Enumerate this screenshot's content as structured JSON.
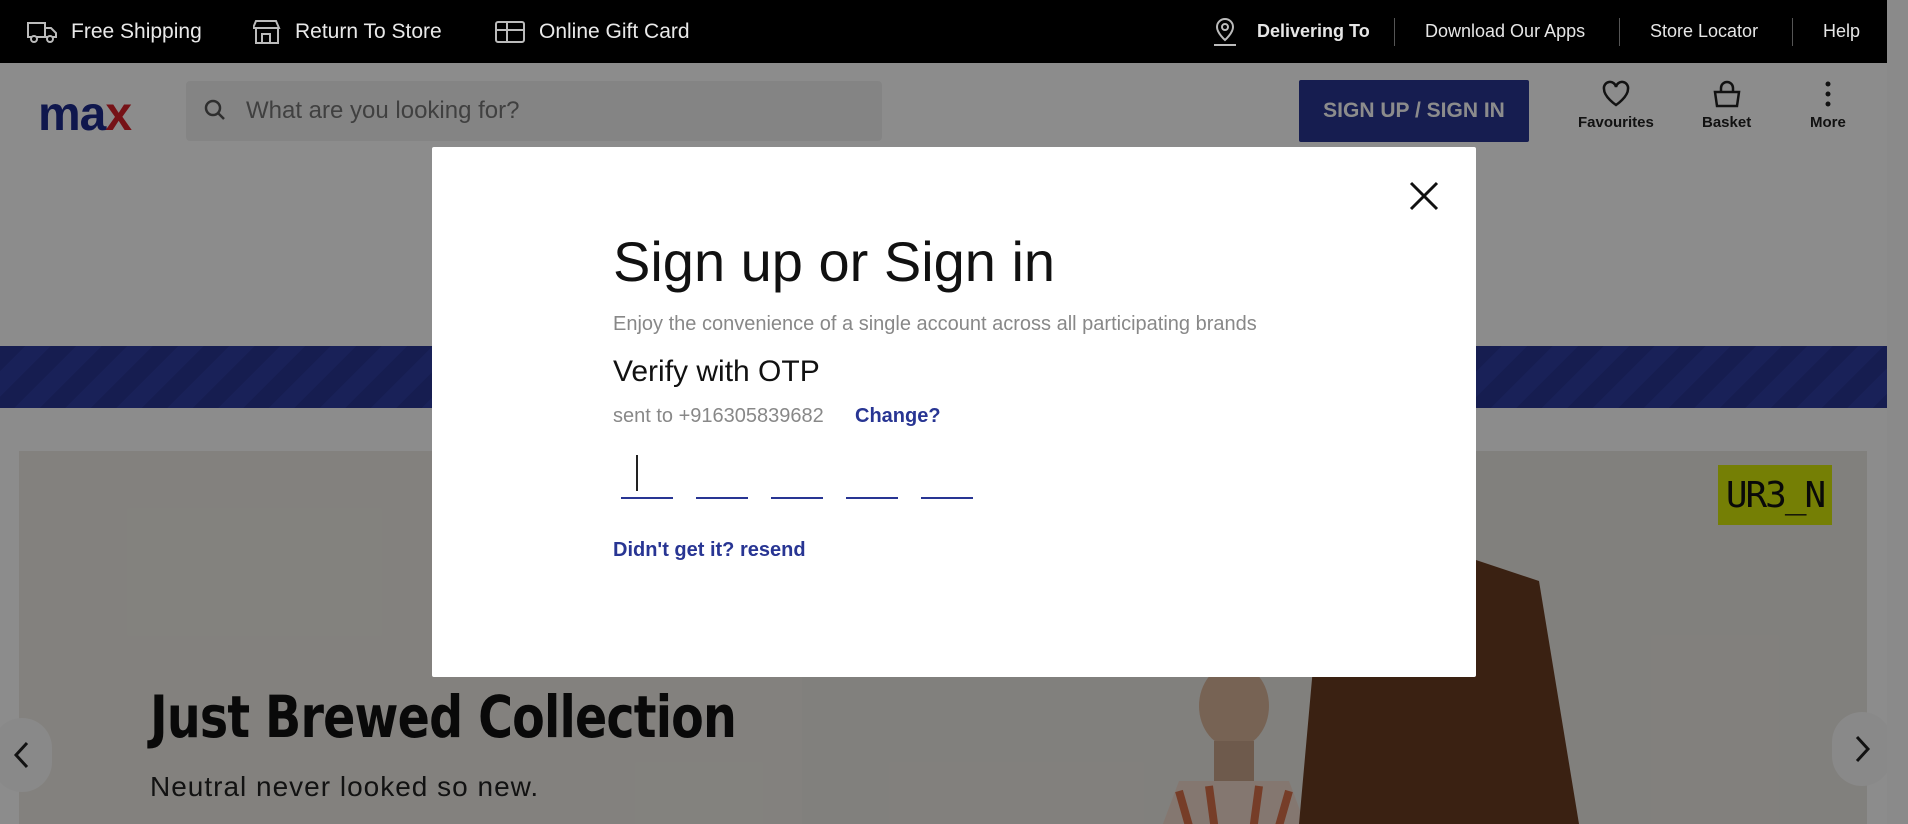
{
  "topbar": {
    "free_shipping": "Free Shipping",
    "return_to_store": "Return To Store",
    "online_gift_card": "Online Gift Card",
    "delivering_to": "Delivering To",
    "download_apps": "Download Our Apps",
    "store_locator": "Store Locator",
    "help": "Help"
  },
  "header": {
    "logo_main": "ma",
    "logo_accent": "x",
    "search_placeholder": "What are you looking for?",
    "signin_label": "SIGN UP / SIGN IN",
    "favourites": "Favourites",
    "basket": "Basket",
    "more": "More"
  },
  "hero": {
    "title": "Just Brewed Collection",
    "subtitle": "Neutral never looked so new.",
    "brand": "UR3_N"
  },
  "modal": {
    "title": "Sign up or Sign in",
    "subtitle": "Enjoy the convenience of a single account across all participating brands",
    "otp_title": "Verify with OTP",
    "sent_to": "sent to +916305839682",
    "change": "Change?",
    "resend": "Didn't get it? resend"
  },
  "colors": {
    "brand_blue": "#283593",
    "brand_red": "#d8222a",
    "badge_yellow": "#d6e70a"
  }
}
